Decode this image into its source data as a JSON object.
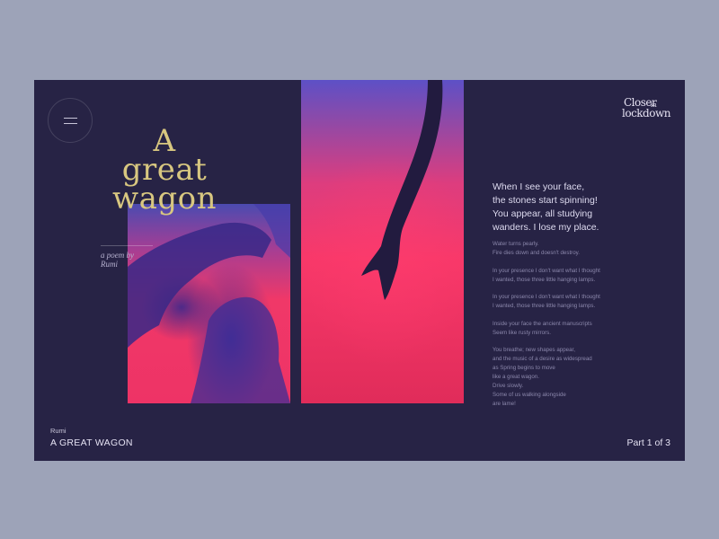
{
  "header": {
    "menu_icon": "hamburger-menu-icon",
    "logo": {
      "line1": "Closer",
      "small": "in",
      "line2": "lockdown"
    }
  },
  "title": {
    "line1": "A",
    "line2": "great",
    "line3": "wagon"
  },
  "subtitle": {
    "line1": "a poem by",
    "line2": "Rumi"
  },
  "poem": {
    "lead": [
      "When I see your face,",
      "the stones start spinning!",
      "You appear, all studying",
      "wanders. I lose my place."
    ],
    "stanzas": [
      [
        "Water turns pearly.",
        "Fire dies down and doesn't destroy."
      ],
      [
        "In your presence I don't want what I thought",
        "I wanted, those three little hanging lamps."
      ],
      [
        "In your presence I don't want what I thought",
        "I wanted, those three little hanging lamps."
      ],
      [
        "Inside your face the ancient manuscripts",
        "Seem like rusty mirrors."
      ],
      [
        "You breathe; new shapes appear,",
        "and the music of a desire as widespread",
        "as Spring begins to move",
        "like a great wagon.",
        "Drive slowly.",
        "Some of us walking alongside",
        "are lame!"
      ]
    ]
  },
  "footer": {
    "author": "Rumi",
    "title": "A GREAT WAGON",
    "part": "Part 1 of 3"
  },
  "colors": {
    "page_bg": "#9da3b8",
    "panel_bg": "#272345",
    "title_gold": "#d8c780",
    "accent_pink": "#f03868",
    "accent_violet": "#5d50c6"
  }
}
